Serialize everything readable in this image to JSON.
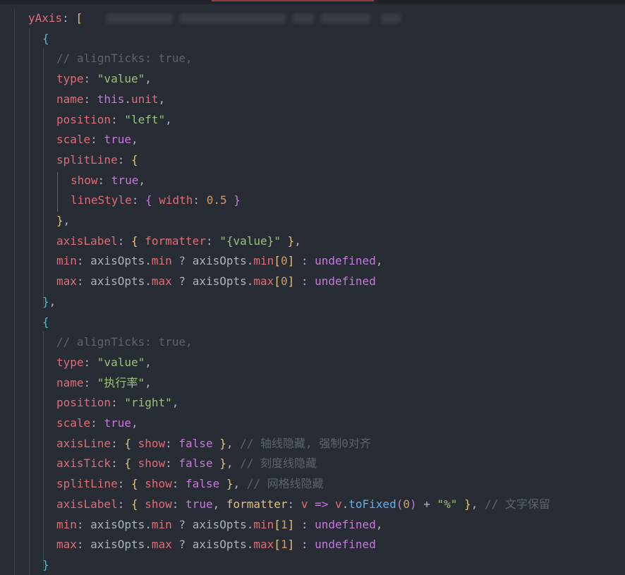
{
  "editor": {
    "theme": "dark",
    "colors": {
      "background": "#282c34",
      "property": "#e06c75",
      "string": "#98c379",
      "number": "#d19a66",
      "keyword": "#c678dd",
      "function": "#61afef",
      "comment": "#5c6370",
      "bracket_level_1": "#e5c07b",
      "bracket_level_2": "#c678dd",
      "bracket_level_3": "#56b6c2"
    },
    "lines": [
      {
        "indent": 1,
        "tokens": [
          {
            "t": "yAxis",
            "c": "key"
          },
          {
            "t": ": ",
            "c": "pl"
          },
          {
            "t": "[",
            "c": "p1"
          }
        ]
      },
      {
        "indent": 2,
        "tokens": [
          {
            "t": "{",
            "c": "p3"
          }
        ]
      },
      {
        "indent": 3,
        "tokens": [
          {
            "t": "// alignTicks: true,",
            "c": "cm"
          }
        ]
      },
      {
        "indent": 3,
        "tokens": [
          {
            "t": "type",
            "c": "key"
          },
          {
            "t": ": ",
            "c": "pl"
          },
          {
            "t": "\"value\"",
            "c": "str"
          },
          {
            "t": ",",
            "c": "pl"
          }
        ]
      },
      {
        "indent": 3,
        "tokens": [
          {
            "t": "name",
            "c": "key"
          },
          {
            "t": ": ",
            "c": "pl"
          },
          {
            "t": "this",
            "c": "kw"
          },
          {
            "t": ".",
            "c": "pl"
          },
          {
            "t": "unit",
            "c": "key"
          },
          {
            "t": ",",
            "c": "pl"
          }
        ]
      },
      {
        "indent": 3,
        "tokens": [
          {
            "t": "position",
            "c": "key"
          },
          {
            "t": ": ",
            "c": "pl"
          },
          {
            "t": "\"left\"",
            "c": "str"
          },
          {
            "t": ",",
            "c": "pl"
          }
        ]
      },
      {
        "indent": 3,
        "tokens": [
          {
            "t": "scale",
            "c": "key"
          },
          {
            "t": ": ",
            "c": "pl"
          },
          {
            "t": "true",
            "c": "kw"
          },
          {
            "t": ",",
            "c": "pl"
          }
        ]
      },
      {
        "indent": 3,
        "tokens": [
          {
            "t": "splitLine",
            "c": "key"
          },
          {
            "t": ": ",
            "c": "pl"
          },
          {
            "t": "{",
            "c": "p1"
          }
        ]
      },
      {
        "indent": 4,
        "tokens": [
          {
            "t": "show",
            "c": "key"
          },
          {
            "t": ": ",
            "c": "pl"
          },
          {
            "t": "true",
            "c": "kw"
          },
          {
            "t": ",",
            "c": "pl"
          }
        ]
      },
      {
        "indent": 4,
        "tokens": [
          {
            "t": "lineStyle",
            "c": "key"
          },
          {
            "t": ": ",
            "c": "pl"
          },
          {
            "t": "{",
            "c": "p2"
          },
          {
            "t": " ",
            "c": "pl"
          },
          {
            "t": "width",
            "c": "key"
          },
          {
            "t": ": ",
            "c": "pl"
          },
          {
            "t": "0.5",
            "c": "num"
          },
          {
            "t": " ",
            "c": "pl"
          },
          {
            "t": "}",
            "c": "p2"
          }
        ]
      },
      {
        "indent": 3,
        "tokens": [
          {
            "t": "}",
            "c": "p1"
          },
          {
            "t": ",",
            "c": "pl"
          }
        ]
      },
      {
        "indent": 3,
        "tokens": [
          {
            "t": "axisLabel",
            "c": "key"
          },
          {
            "t": ": ",
            "c": "pl"
          },
          {
            "t": "{",
            "c": "p1"
          },
          {
            "t": " ",
            "c": "pl"
          },
          {
            "t": "formatter",
            "c": "key"
          },
          {
            "t": ": ",
            "c": "pl"
          },
          {
            "t": "\"{value}\"",
            "c": "str"
          },
          {
            "t": " ",
            "c": "pl"
          },
          {
            "t": "}",
            "c": "p1"
          },
          {
            "t": ",",
            "c": "pl"
          }
        ]
      },
      {
        "indent": 3,
        "tokens": [
          {
            "t": "min",
            "c": "key"
          },
          {
            "t": ": ",
            "c": "pl"
          },
          {
            "t": "axisOpts",
            "c": "pl"
          },
          {
            "t": ".",
            "c": "pl"
          },
          {
            "t": "min",
            "c": "key"
          },
          {
            "t": " ? ",
            "c": "pl"
          },
          {
            "t": "axisOpts",
            "c": "pl"
          },
          {
            "t": ".",
            "c": "pl"
          },
          {
            "t": "min",
            "c": "key"
          },
          {
            "t": "[",
            "c": "p1"
          },
          {
            "t": "0",
            "c": "num"
          },
          {
            "t": "]",
            "c": "p1"
          },
          {
            "t": " : ",
            "c": "pl"
          },
          {
            "t": "undefined",
            "c": "kw"
          },
          {
            "t": ",",
            "c": "pl"
          }
        ]
      },
      {
        "indent": 3,
        "tokens": [
          {
            "t": "max",
            "c": "key"
          },
          {
            "t": ": ",
            "c": "pl"
          },
          {
            "t": "axisOpts",
            "c": "pl"
          },
          {
            "t": ".",
            "c": "pl"
          },
          {
            "t": "max",
            "c": "key"
          },
          {
            "t": " ? ",
            "c": "pl"
          },
          {
            "t": "axisOpts",
            "c": "pl"
          },
          {
            "t": ".",
            "c": "pl"
          },
          {
            "t": "max",
            "c": "key"
          },
          {
            "t": "[",
            "c": "p1"
          },
          {
            "t": "0",
            "c": "num"
          },
          {
            "t": "]",
            "c": "p1"
          },
          {
            "t": " : ",
            "c": "pl"
          },
          {
            "t": "undefined",
            "c": "kw"
          }
        ]
      },
      {
        "indent": 2,
        "tokens": [
          {
            "t": "}",
            "c": "p3"
          },
          {
            "t": ",",
            "c": "pl"
          }
        ]
      },
      {
        "indent": 2,
        "tokens": [
          {
            "t": "{",
            "c": "p3"
          }
        ]
      },
      {
        "indent": 3,
        "tokens": [
          {
            "t": "// alignTicks: true,",
            "c": "cm"
          }
        ]
      },
      {
        "indent": 3,
        "tokens": [
          {
            "t": "type",
            "c": "key"
          },
          {
            "t": ": ",
            "c": "pl"
          },
          {
            "t": "\"value\"",
            "c": "str"
          },
          {
            "t": ",",
            "c": "pl"
          }
        ]
      },
      {
        "indent": 3,
        "tokens": [
          {
            "t": "name",
            "c": "key"
          },
          {
            "t": ": ",
            "c": "pl"
          },
          {
            "t": "\"执行率\"",
            "c": "str"
          },
          {
            "t": ",",
            "c": "pl"
          }
        ]
      },
      {
        "indent": 3,
        "tokens": [
          {
            "t": "position",
            "c": "key"
          },
          {
            "t": ": ",
            "c": "pl"
          },
          {
            "t": "\"right\"",
            "c": "str"
          },
          {
            "t": ",",
            "c": "pl"
          }
        ]
      },
      {
        "indent": 3,
        "tokens": [
          {
            "t": "scale",
            "c": "key"
          },
          {
            "t": ": ",
            "c": "pl"
          },
          {
            "t": "true",
            "c": "kw"
          },
          {
            "t": ",",
            "c": "pl"
          }
        ]
      },
      {
        "indent": 3,
        "tokens": [
          {
            "t": "axisLine",
            "c": "key"
          },
          {
            "t": ": ",
            "c": "pl"
          },
          {
            "t": "{",
            "c": "p1"
          },
          {
            "t": " ",
            "c": "pl"
          },
          {
            "t": "show",
            "c": "key"
          },
          {
            "t": ": ",
            "c": "pl"
          },
          {
            "t": "false",
            "c": "kw"
          },
          {
            "t": " ",
            "c": "pl"
          },
          {
            "t": "}",
            "c": "p1"
          },
          {
            "t": ", ",
            "c": "pl"
          },
          {
            "t": "// 轴线隐藏, 强制0对齐",
            "c": "cm"
          }
        ]
      },
      {
        "indent": 3,
        "tokens": [
          {
            "t": "axisTick",
            "c": "key"
          },
          {
            "t": ": ",
            "c": "pl"
          },
          {
            "t": "{",
            "c": "p1"
          },
          {
            "t": " ",
            "c": "pl"
          },
          {
            "t": "show",
            "c": "key"
          },
          {
            "t": ": ",
            "c": "pl"
          },
          {
            "t": "false",
            "c": "kw"
          },
          {
            "t": " ",
            "c": "pl"
          },
          {
            "t": "}",
            "c": "p1"
          },
          {
            "t": ", ",
            "c": "pl"
          },
          {
            "t": "// 刻度线隐藏",
            "c": "cm"
          }
        ]
      },
      {
        "indent": 3,
        "tokens": [
          {
            "t": "splitLine",
            "c": "key"
          },
          {
            "t": ": ",
            "c": "pl"
          },
          {
            "t": "{",
            "c": "p1"
          },
          {
            "t": " ",
            "c": "pl"
          },
          {
            "t": "show",
            "c": "key"
          },
          {
            "t": ": ",
            "c": "pl"
          },
          {
            "t": "false",
            "c": "kw"
          },
          {
            "t": " ",
            "c": "pl"
          },
          {
            "t": "}",
            "c": "p1"
          },
          {
            "t": ", ",
            "c": "pl"
          },
          {
            "t": "// 网格线隐藏",
            "c": "cm"
          }
        ]
      },
      {
        "indent": 3,
        "tokens": [
          {
            "t": "axisLabel",
            "c": "key"
          },
          {
            "t": ": ",
            "c": "pl"
          },
          {
            "t": "{",
            "c": "p1"
          },
          {
            "t": " ",
            "c": "pl"
          },
          {
            "t": "show",
            "c": "key"
          },
          {
            "t": ": ",
            "c": "pl"
          },
          {
            "t": "true",
            "c": "kw"
          },
          {
            "t": ", ",
            "c": "pl"
          },
          {
            "t": "formatter",
            "c": "p1"
          },
          {
            "t": ": ",
            "c": "pl"
          },
          {
            "t": "v",
            "c": "key"
          },
          {
            "t": " => ",
            "c": "kw"
          },
          {
            "t": "v",
            "c": "key"
          },
          {
            "t": ".",
            "c": "pl"
          },
          {
            "t": "toFixed",
            "c": "fn"
          },
          {
            "t": "(",
            "c": "p2"
          },
          {
            "t": "0",
            "c": "num"
          },
          {
            "t": ")",
            "c": "p2"
          },
          {
            "t": " + ",
            "c": "pl"
          },
          {
            "t": "\"%\"",
            "c": "str"
          },
          {
            "t": " ",
            "c": "pl"
          },
          {
            "t": "}",
            "c": "p1"
          },
          {
            "t": ", ",
            "c": "pl"
          },
          {
            "t": "// 文字保留",
            "c": "cm"
          }
        ]
      },
      {
        "indent": 3,
        "tokens": [
          {
            "t": "min",
            "c": "key"
          },
          {
            "t": ": ",
            "c": "pl"
          },
          {
            "t": "axisOpts",
            "c": "pl"
          },
          {
            "t": ".",
            "c": "pl"
          },
          {
            "t": "min",
            "c": "key"
          },
          {
            "t": " ? ",
            "c": "pl"
          },
          {
            "t": "axisOpts",
            "c": "pl"
          },
          {
            "t": ".",
            "c": "pl"
          },
          {
            "t": "min",
            "c": "key"
          },
          {
            "t": "[",
            "c": "p1"
          },
          {
            "t": "1",
            "c": "num"
          },
          {
            "t": "]",
            "c": "p1"
          },
          {
            "t": " : ",
            "c": "pl"
          },
          {
            "t": "undefined",
            "c": "kw"
          },
          {
            "t": ",",
            "c": "pl"
          }
        ]
      },
      {
        "indent": 3,
        "tokens": [
          {
            "t": "max",
            "c": "key"
          },
          {
            "t": ": ",
            "c": "pl"
          },
          {
            "t": "axisOpts",
            "c": "pl"
          },
          {
            "t": ".",
            "c": "pl"
          },
          {
            "t": "max",
            "c": "key"
          },
          {
            "t": " ? ",
            "c": "pl"
          },
          {
            "t": "axisOpts",
            "c": "pl"
          },
          {
            "t": ".",
            "c": "pl"
          },
          {
            "t": "max",
            "c": "key"
          },
          {
            "t": "[",
            "c": "p1"
          },
          {
            "t": "1",
            "c": "num"
          },
          {
            "t": "]",
            "c": "p1"
          },
          {
            "t": " : ",
            "c": "pl"
          },
          {
            "t": "undefined",
            "c": "kw"
          }
        ]
      },
      {
        "indent": 2,
        "tokens": [
          {
            "t": "}",
            "c": "p3"
          }
        ]
      }
    ]
  }
}
